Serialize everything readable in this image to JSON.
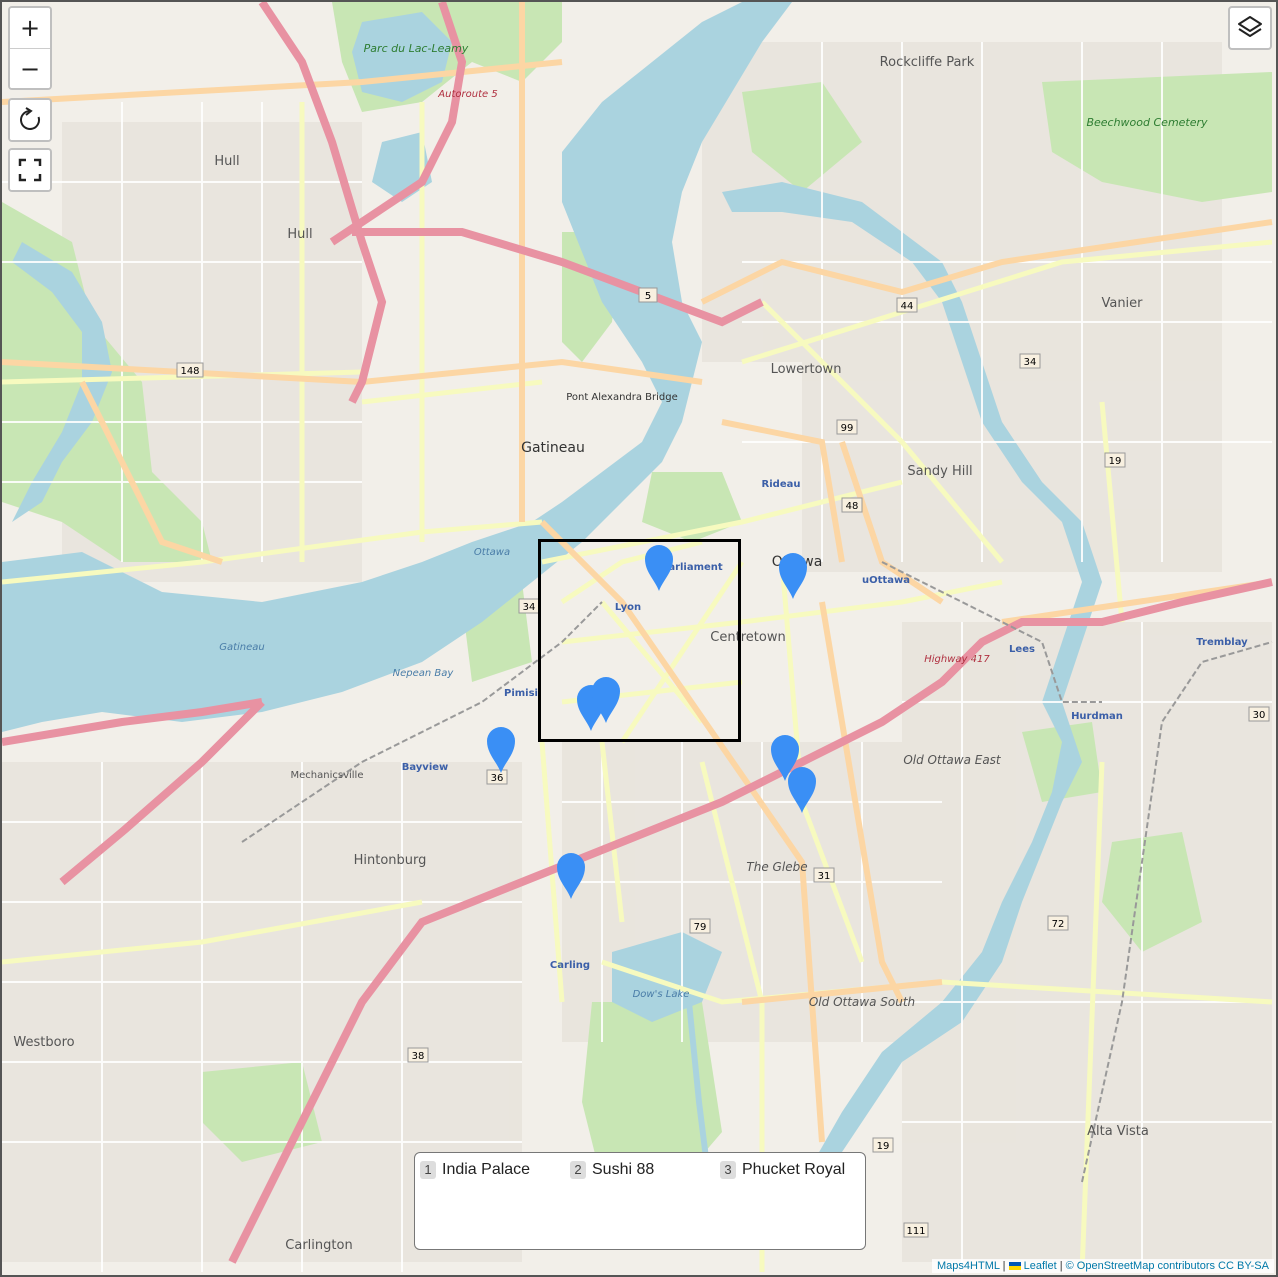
{
  "controls": {
    "zoom_in": "+",
    "zoom_out": "−",
    "reload": "↺",
    "fullscreen": "fullscreen-icon",
    "layers": "layers-icon"
  },
  "legend": {
    "items": [
      {
        "number": "1",
        "label": "India Palace"
      },
      {
        "number": "2",
        "label": "Sushi 88"
      },
      {
        "number": "3",
        "label": "Phucket Royal"
      }
    ]
  },
  "attribution": {
    "maps4html": "Maps4HTML",
    "leaflet": "Leaflet",
    "osm": "© OpenStreetMap contributors CC BY-SA",
    "sep": "|"
  },
  "map": {
    "labels": {
      "hull": "Hull",
      "hull2": "Hull",
      "gatineau": "Gatineau",
      "ottawa": "Ottawa",
      "centretown": "Centretown",
      "lowertown": "Lowertown",
      "sandy_hill": "Sandy Hill",
      "vanier": "Vanier",
      "rockcliffe": "Rockcliffe Park",
      "hintonburg": "Hintonburg",
      "westboro": "Westboro",
      "glebe": "The Glebe",
      "old_ottawa_east": "Old Ottawa East",
      "old_ottawa_south": "Old Ottawa South",
      "alta_vista": "Alta Vista",
      "carlington": "Carlington",
      "mechanicsville": "Mechanicsville",
      "parliament": "Parliament",
      "rideau": "Rideau",
      "lyon": "Lyon",
      "pimisi": "Pimisi",
      "bayview": "Bayview",
      "carling": "Carling",
      "lees": "Lees",
      "hurdman": "Hurdman",
      "tremblay": "Tremblay",
      "uottawa": "uOttawa",
      "lac_leamy": "Parc du Lac-Leamy",
      "beechwood": "Beechwood Cemetery",
      "dows_lake": "Dow's Lake",
      "nepean_bay": "Nepean Bay",
      "gatineau_river": "Gatineau",
      "ottawa_river": "Ottawa",
      "pont": "Pont Alexandra Bridge",
      "hwy417": "Highway 417",
      "autoroute5": "Autoroute 5"
    },
    "shields": [
      "5",
      "148",
      "44",
      "34",
      "99",
      "48",
      "19",
      "36",
      "34",
      "79",
      "31",
      "72",
      "38",
      "19",
      "111",
      "30"
    ]
  },
  "markers": [
    {
      "name": "marker-1"
    },
    {
      "name": "marker-2"
    },
    {
      "name": "marker-3"
    },
    {
      "name": "marker-4"
    },
    {
      "name": "marker-5"
    },
    {
      "name": "marker-6"
    },
    {
      "name": "marker-7"
    },
    {
      "name": "marker-8"
    }
  ],
  "colors": {
    "water": "#aad3df",
    "park": "#c8e6b4",
    "land": "#f2efe9",
    "highway": "#e892a2",
    "primary": "#fcd6a4",
    "secondary": "#f7fabf",
    "marker": "#3a8ff5"
  }
}
